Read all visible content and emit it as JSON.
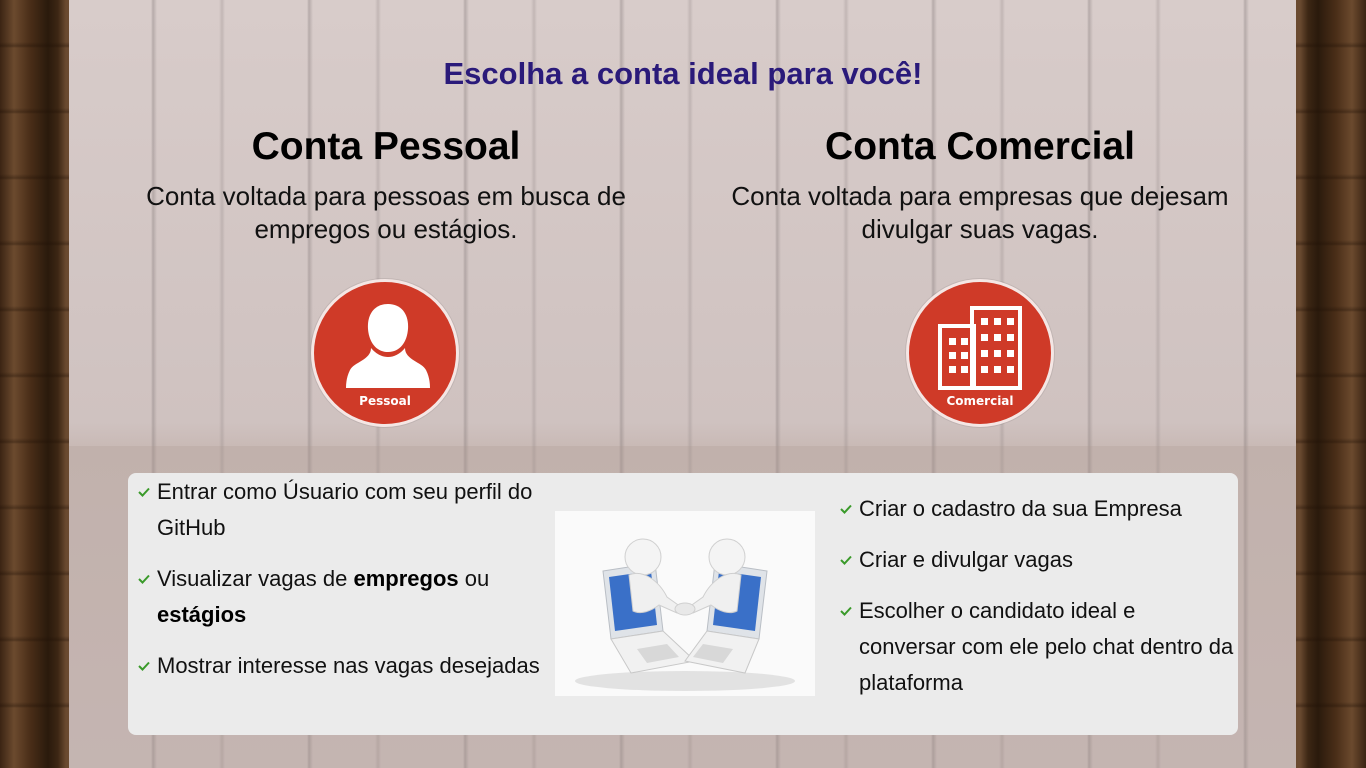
{
  "headline": "Escolha a conta ideal para você!",
  "pessoal": {
    "title": "Conta Pessoal",
    "description": "Conta voltada para pessoas em busca de empregos ou estágios.",
    "badge_label": "Pessoal",
    "icon": "person-icon"
  },
  "comercial": {
    "title": "Conta Comercial",
    "description": "Conta voltada para empresas que dejesam divulgar suas vagas.",
    "badge_label": "Comercial",
    "icon": "building-icon"
  },
  "features_pessoal": {
    "item1": "Entrar como Úsuario com seu perfil do GitHub",
    "item2_pre": "Visualizar vagas de ",
    "item2_bold1": "empregos",
    "item2_mid": " ou ",
    "item2_bold2": "estágios",
    "item3": "Mostrar interesse nas vagas desejadas"
  },
  "features_comercial": {
    "item1": "Criar o cadastro da sua Empresa",
    "item2": "Criar e divulgar vagas",
    "item3": "Escolher o candidato ideal e conversar com ele pelo chat dentro da plataforma"
  },
  "colors": {
    "headline": "#2a1a7a",
    "badge": "#cf3a28",
    "check": "#3a9a2a"
  }
}
